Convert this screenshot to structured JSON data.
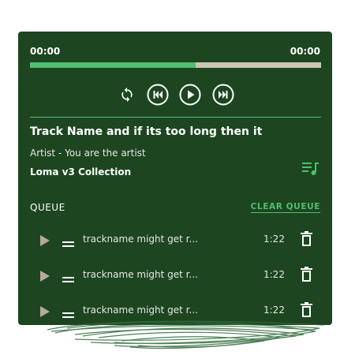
{
  "player": {
    "time_elapsed": "00:00",
    "time_total": "00:00",
    "progress": 0.57
  },
  "track": {
    "title": "Track Name and if its too long then it",
    "artist": "Artist - You are the artist",
    "collection": "Loma v3 Collection"
  },
  "queue": {
    "label": "QUEUE",
    "clear_label": "CLEAR QUEUE",
    "items": [
      {
        "name": "trackname might get r...",
        "duration": "1:22"
      },
      {
        "name": "trackname might get r...",
        "duration": "1:22"
      },
      {
        "name": "trackname might get r...",
        "duration": "1:22"
      }
    ]
  },
  "colors": {
    "panel_bg": "#1d4620",
    "accent": "#4fbf70",
    "progress_track": "#cfc4b4",
    "muted_icon": "#b5aa9b",
    "scribble": "#2e6b3a"
  },
  "icons": {
    "repeat": "repeat-icon",
    "previous": "skip-previous-icon",
    "play": "play-icon",
    "next": "skip-next-icon",
    "playlist": "playlist-music-icon",
    "queue_play": "play-icon",
    "drag": "drag-handle-icon",
    "delete": "trash-icon"
  }
}
